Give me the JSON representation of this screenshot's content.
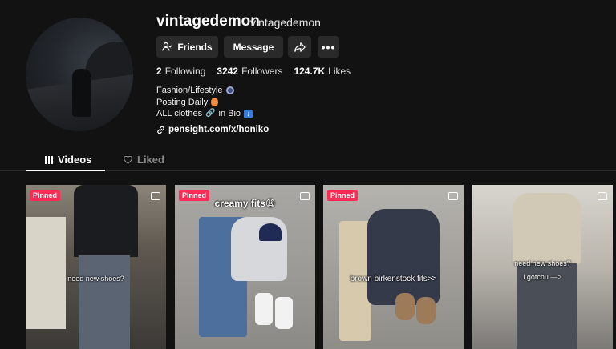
{
  "profile": {
    "username": "vintagedemon",
    "handle": "vintagedemon",
    "buttons": {
      "friends": "Friends",
      "message": "Message"
    },
    "stats": [
      {
        "value": "2",
        "label": "Following"
      },
      {
        "value": "3242",
        "label": "Followers"
      },
      {
        "value": "124.7K",
        "label": "Likes"
      }
    ],
    "bio": {
      "line1": "Fashion/Lifestyle",
      "line2": "Posting Daily",
      "line3a": "ALL clothes",
      "line3b": "in Bio"
    },
    "link": "pensight.com/x/honiko"
  },
  "tabs": {
    "videos": "Videos",
    "liked": "Liked"
  },
  "videos": [
    {
      "badge": "Pinned",
      "caption": "need new shoes?"
    },
    {
      "badge": "Pinned",
      "caption": "creamy fits😩"
    },
    {
      "badge": "Pinned",
      "caption": "brown birkenstock fits>>"
    },
    {
      "caption": "need new shoes?",
      "caption2": "i gotchu —>"
    }
  ],
  "colors": {
    "background": "#121212",
    "pinned": "#fe2c55",
    "button": "#2a2a2a"
  }
}
